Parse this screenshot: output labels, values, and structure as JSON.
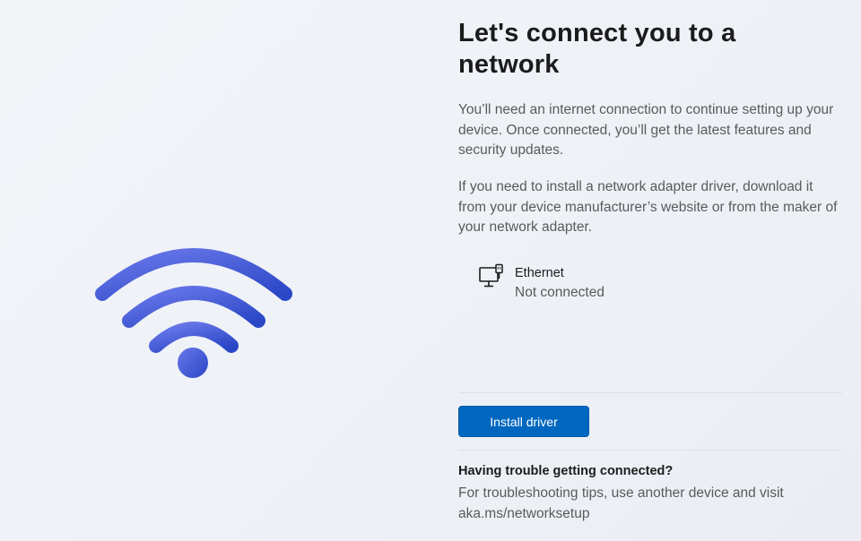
{
  "illustration": {
    "icon": "wifi-icon",
    "gradient_start": "#5b6fe6",
    "gradient_end": "#2b4ac8"
  },
  "title": "Let's connect you to a network",
  "description": [
    "You’ll need an internet connection to continue setting up your device. Once connected, you’ll get the latest features and security updates.",
    "If you need to install a network adapter driver, download it from your device manufacturer’s website or from the maker of your network adapter."
  ],
  "networks": [
    {
      "icon": "ethernet-icon",
      "name": "Ethernet",
      "status": "Not connected"
    }
  ],
  "actions": {
    "install_driver_label": "Install driver",
    "accent": "#0067c0"
  },
  "help": {
    "heading": "Having trouble getting connected?",
    "text": "For troubleshooting tips, use another device and visit aka.ms/networksetup"
  }
}
